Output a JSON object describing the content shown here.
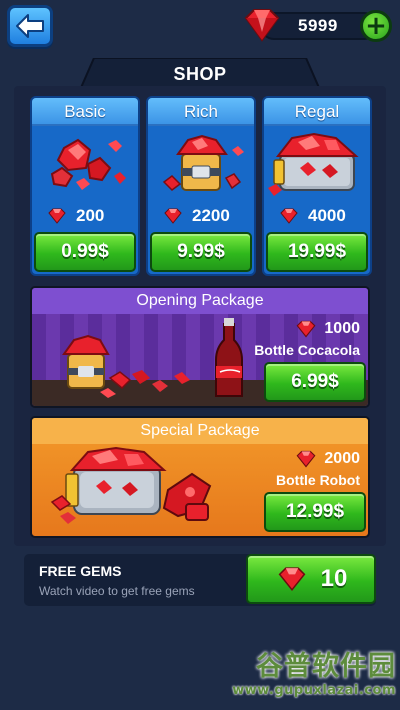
{
  "header": {
    "gem_count": "5999",
    "back_icon": "back-arrow-icon",
    "add_icon": "plus-icon",
    "title": "SHOP"
  },
  "colors": {
    "accent_blue": "#1769c8",
    "buy_green": "#2fb81c",
    "gem_red": "#e8212c",
    "opening_purple": "#6b39ae",
    "special_orange": "#f39a2a"
  },
  "gem_packs": [
    {
      "name": "Basic",
      "amount": "200",
      "price": "0.99$"
    },
    {
      "name": "Rich",
      "amount": "2200",
      "price": "9.99$"
    },
    {
      "name": "Regal",
      "amount": "4000",
      "price": "19.99$"
    }
  ],
  "opening_package": {
    "title": "Opening Package",
    "amount": "1000",
    "item": "Bottle Cocacola",
    "price": "6.99$"
  },
  "special_package": {
    "title": "Special Package",
    "amount": "2000",
    "item": "Bottle Robot",
    "price": "12.99$"
  },
  "free_gems": {
    "title": "FREE GEMS",
    "subtitle": "Watch video to get free gems",
    "amount": "10"
  },
  "watermark": {
    "text": "谷普软件园",
    "url": "www.gupuxlazai.com"
  }
}
